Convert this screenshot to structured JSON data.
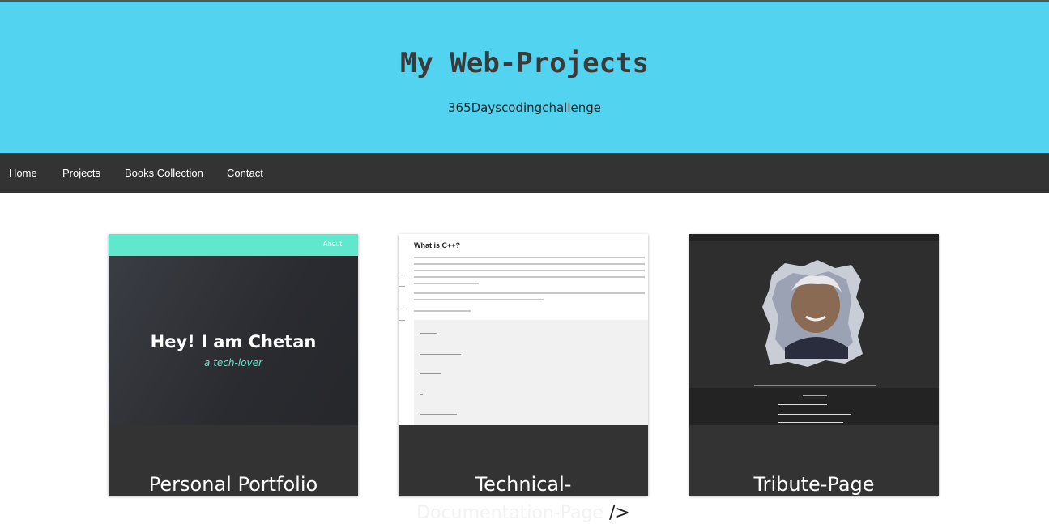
{
  "header": {
    "title": "My Web-Projects",
    "subtitle": "365Dayscodingchallenge",
    "background_color": "#52d4f1"
  },
  "nav": {
    "items": [
      {
        "label": "Home"
      },
      {
        "label": "Projects"
      },
      {
        "label": "Books Collection"
      },
      {
        "label": "Contact"
      }
    ]
  },
  "projects": [
    {
      "label": "Personal Portfolio",
      "thumbnail": {
        "nav_link": "About",
        "heading": "Hey! I am Chetan",
        "tagline": "a tech-lover"
      }
    },
    {
      "label_line1": "Technical-",
      "label_line2": "Documentation-Page",
      "label_suffix": "/>",
      "thumbnail": {
        "heading": "What is C++?"
      }
    },
    {
      "label": "Tribute-Page",
      "thumbnail": {}
    }
  ],
  "colors": {
    "card_background": "#333333",
    "nav_background": "#333333",
    "accent": "#5fe8cc"
  }
}
